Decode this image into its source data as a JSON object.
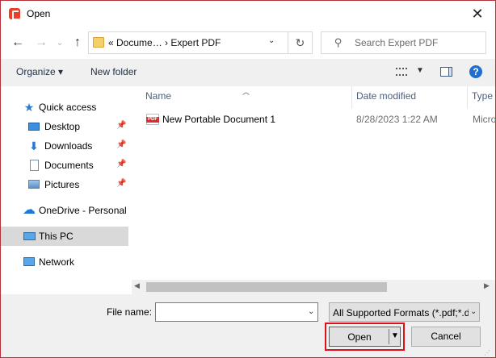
{
  "titlebar": {
    "title": "Open",
    "close_icon": "close-icon"
  },
  "nav": {
    "back_icon": "back-arrow-icon",
    "forward_icon": "forward-arrow-icon",
    "up_icon": "up-arrow-icon",
    "address_path": "«  Docume…  ›  Expert PDF",
    "refresh_icon": "refresh-icon",
    "search_placeholder": "Search Expert PDF"
  },
  "toolbar": {
    "organize_label": "Organize ▾",
    "new_folder_label": "New folder"
  },
  "sidebar": {
    "items": [
      {
        "label": "Quick access",
        "icon": "star-icon"
      },
      {
        "label": "Desktop",
        "icon": "desktop-icon",
        "pinned": true
      },
      {
        "label": "Downloads",
        "icon": "download-icon",
        "pinned": true
      },
      {
        "label": "Documents",
        "icon": "document-icon",
        "pinned": true
      },
      {
        "label": "Pictures",
        "icon": "pictures-icon",
        "pinned": true
      },
      {
        "label": "OneDrive - Personal",
        "icon": "cloud-icon"
      },
      {
        "label": "This PC",
        "icon": "computer-icon",
        "selected": true
      },
      {
        "label": "Network",
        "icon": "network-icon"
      }
    ]
  },
  "files": {
    "columns": [
      "Name",
      "Date modified",
      "Type"
    ],
    "rows": [
      {
        "name": "New Portable Document 1",
        "date": "8/28/2023 1:22 AM",
        "type": "Micro"
      }
    ]
  },
  "bottom": {
    "filename_label": "File name:",
    "filename_value": "",
    "filter_value": "All Supported Formats (*.pdf;*.d",
    "open_label": "Open",
    "cancel_label": "Cancel"
  },
  "colors": {
    "accent": "#0078d7",
    "highlight_box": "#e0101a",
    "window_border": "#b5303a"
  }
}
